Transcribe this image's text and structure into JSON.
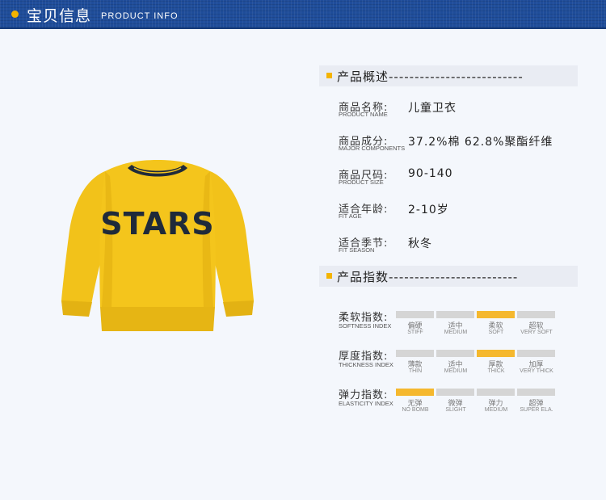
{
  "header": {
    "title": "宝贝信息",
    "subtitle": "PRODUCT INFO"
  },
  "product_image": {
    "print_text": "STARS",
    "colors": {
      "body": "#f2c21a",
      "shadow": "#d9a80f",
      "print": "#1f2a3a",
      "collar": "#1f2a3a"
    }
  },
  "overview": {
    "title": "产品概述--------------------------",
    "rows": [
      {
        "label": "商品名称:",
        "label_en": "PRODUCT NAME",
        "value": "儿童卫衣"
      },
      {
        "label": "商品成分:",
        "label_en": "MAJOR COMPONENTS",
        "value": "37.2%棉 62.8%聚酯纤维"
      },
      {
        "label": "商品尺码:",
        "label_en": "PRODUCT SIZE",
        "value": "90-140"
      },
      {
        "label": "适合年龄:",
        "label_en": "FIT AGE",
        "value": "2-10岁"
      },
      {
        "label": "适合季节:",
        "label_en": "FIT SEASON",
        "value": "秋冬"
      }
    ]
  },
  "indices": {
    "title": "产品指数-------------------------",
    "rows": [
      {
        "label": "柔软指数:",
        "label_en": "SOFTNESS INDEX",
        "selected": 2,
        "options": [
          {
            "cn": "偏硬",
            "en": "STIFF"
          },
          {
            "cn": "适中",
            "en": "MEDIUM"
          },
          {
            "cn": "柔软",
            "en": "SOFT"
          },
          {
            "cn": "超软",
            "en": "VERY SOFT"
          }
        ]
      },
      {
        "label": "厚度指数:",
        "label_en": "THICKNESS INDEX",
        "selected": 2,
        "options": [
          {
            "cn": "薄款",
            "en": "THIN"
          },
          {
            "cn": "适中",
            "en": "MEDIUM"
          },
          {
            "cn": "厚款",
            "en": "THICK"
          },
          {
            "cn": "加厚",
            "en": "VERY THICK"
          }
        ]
      },
      {
        "label": "弹力指数:",
        "label_en": "ELASTICITY INDEX",
        "selected": 0,
        "options": [
          {
            "cn": "无弹",
            "en": "NO BOMB"
          },
          {
            "cn": "微弹",
            "en": "SLIGHT"
          },
          {
            "cn": "弹力",
            "en": "MEDIUM"
          },
          {
            "cn": "超弹",
            "en": "SUPER ELA."
          }
        ]
      }
    ]
  },
  "accent_color": "#f4b400",
  "header_color": "#1f4d9a"
}
